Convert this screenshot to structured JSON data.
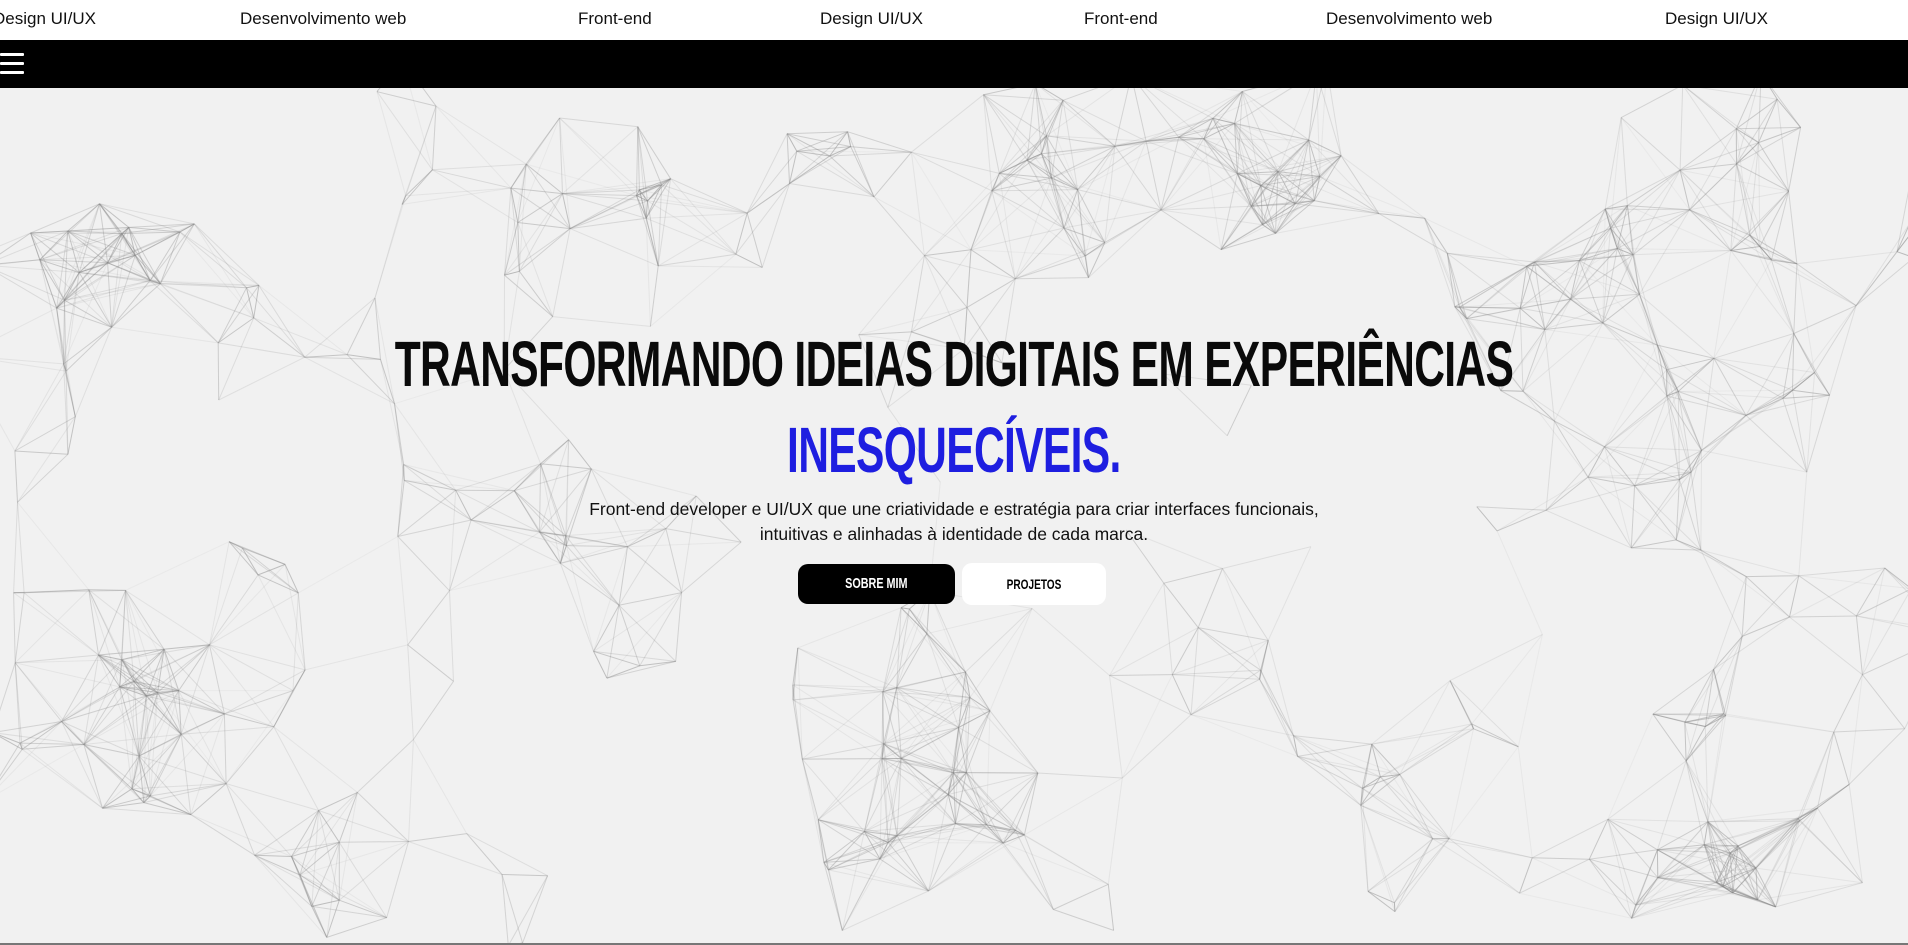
{
  "marquee": {
    "items": [
      "Design UI/UX",
      "Desenvolvimento web",
      "Front-end",
      "Design UI/UX",
      "Front-end",
      "Desenvolvimento web",
      "Design UI/UX"
    ]
  },
  "navbar": {
    "menu_icon": "hamburger-menu-icon",
    "background": "#000000"
  },
  "hero": {
    "headline_line1": "Transformando ideias digitais em experiências",
    "headline_line2": "inesquecíveis.",
    "subtitle_line1": "Front-end developer e UI/UX que une criatividade e estratégia para criar interfaces funcionais,",
    "subtitle_line2": "intuitivas e alinhadas à identidade de cada marca.",
    "primary_button": "Sobre mim",
    "secondary_button": "Projetos",
    "accent_color": "#1e1ee0",
    "background": "#f1f1f1"
  }
}
